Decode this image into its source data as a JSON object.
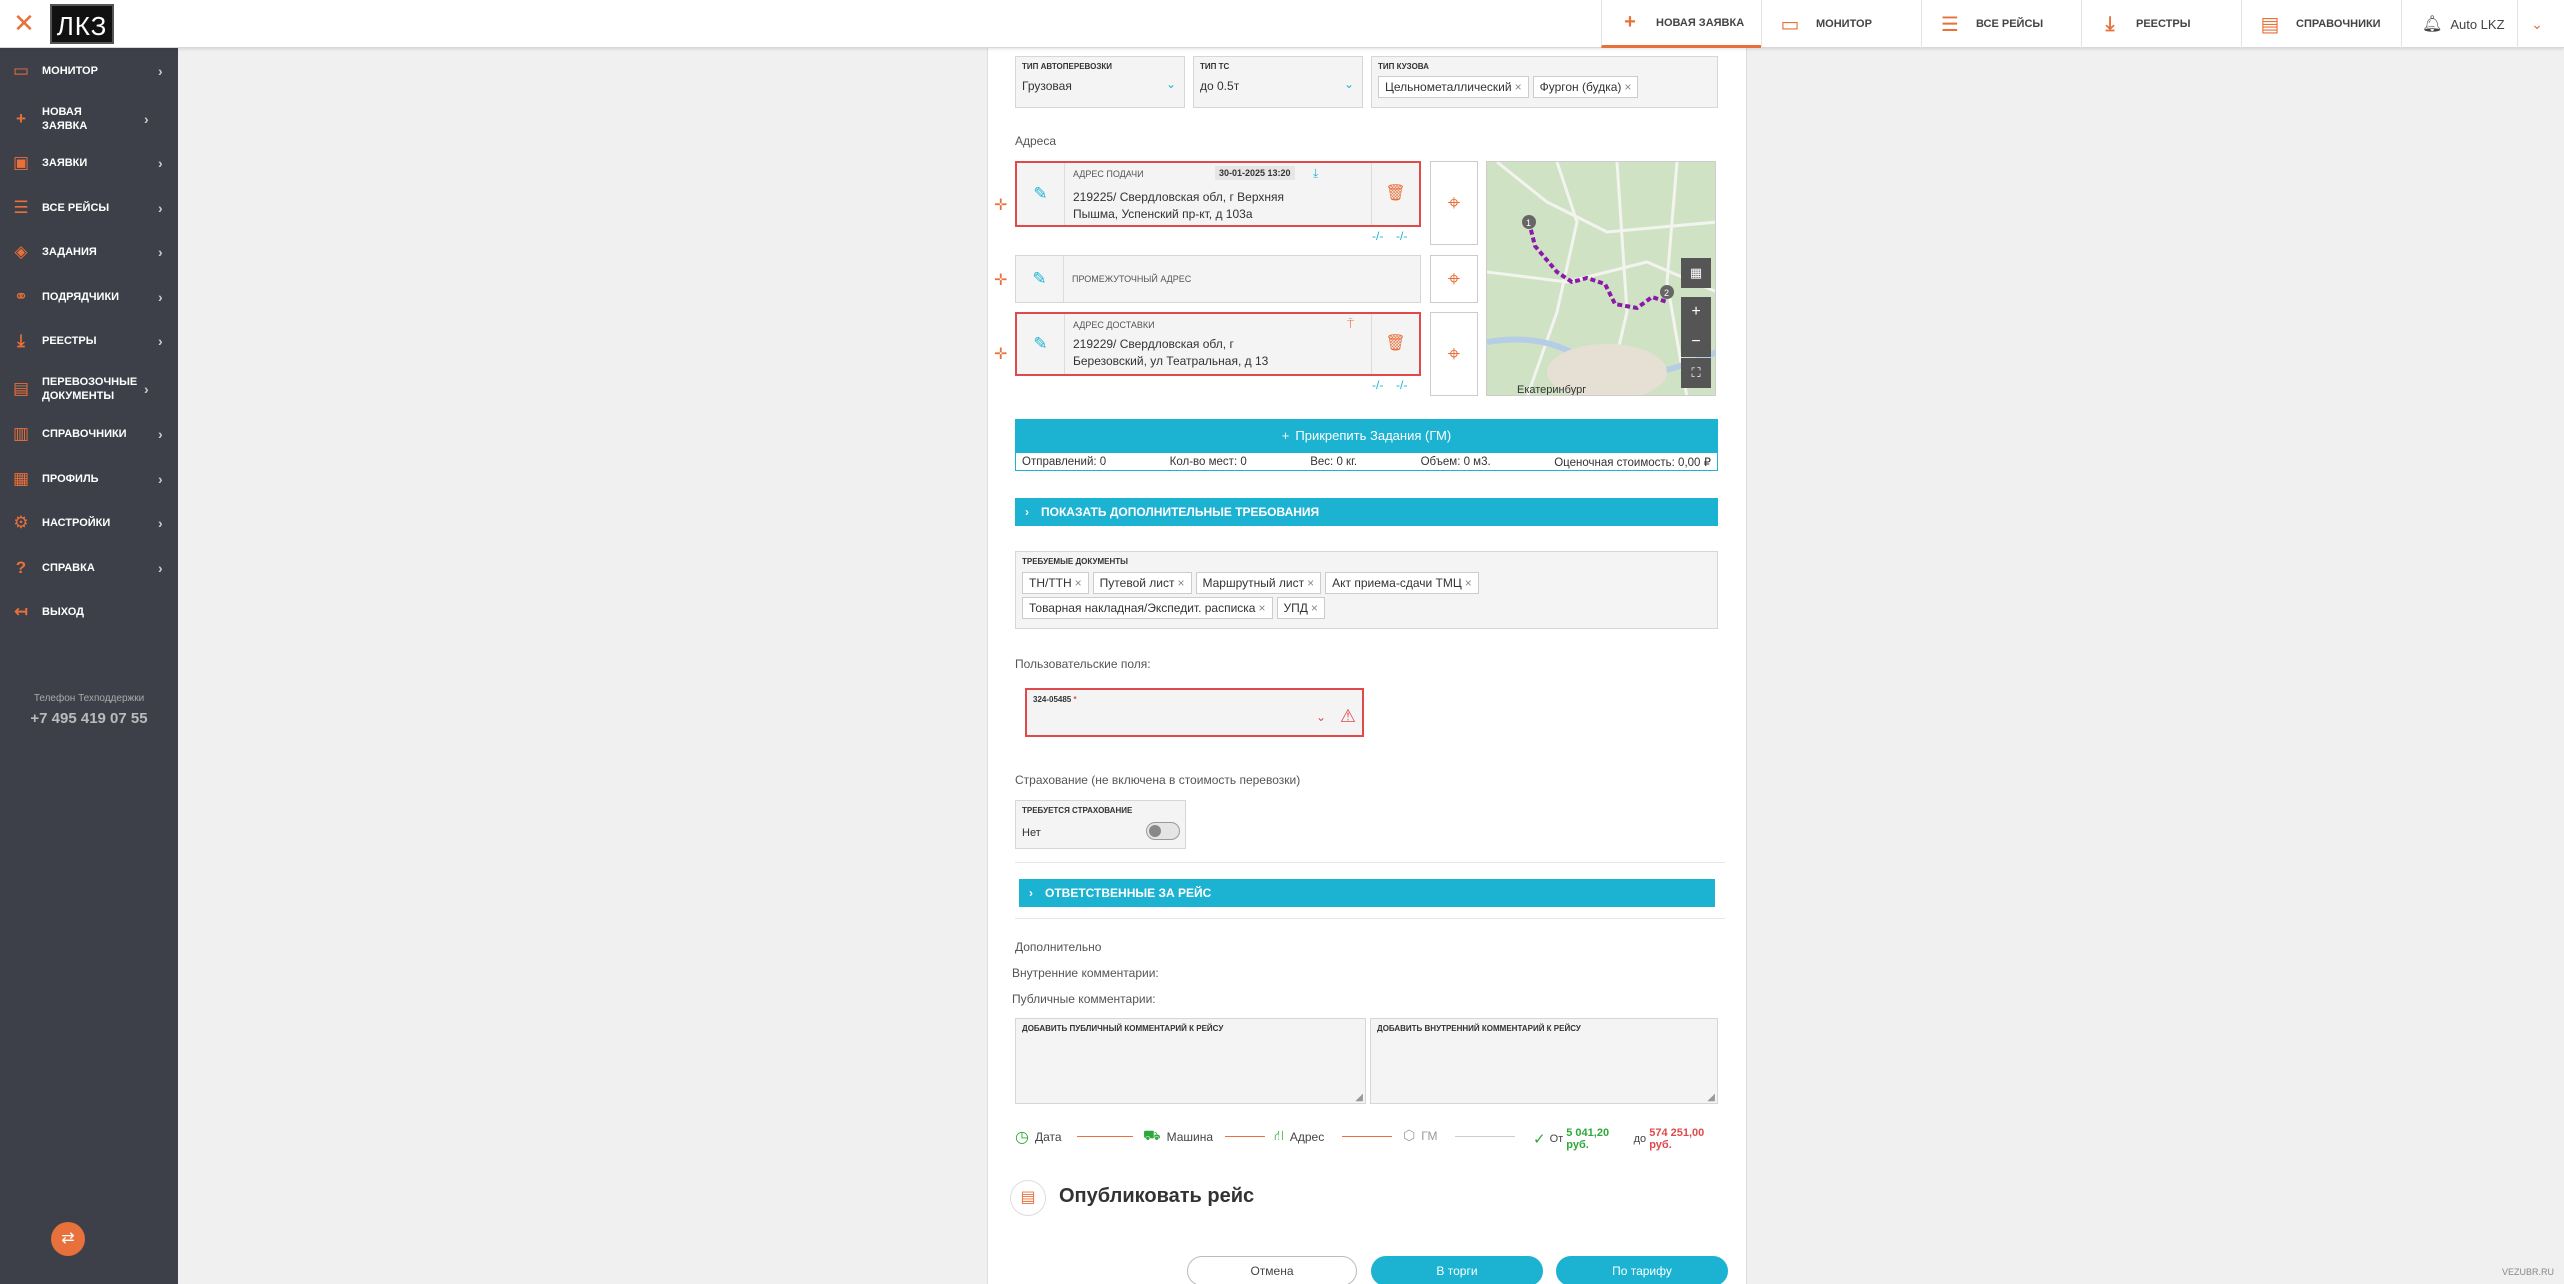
{
  "header": {
    "logo_text": "ЛКЗ",
    "nav": [
      {
        "label": "НОВАЯ ЗАЯВКА",
        "icon": "plus-icon"
      },
      {
        "label": "МОНИТОР",
        "icon": "monitor-icon"
      },
      {
        "label": "ВСЕ РЕЙСЫ",
        "icon": "list-icon"
      },
      {
        "label": "РЕЕСТРЫ",
        "icon": "download-icon"
      },
      {
        "label": "СПРАВОЧНИКИ",
        "icon": "book-icon"
      }
    ],
    "user_name": "Auto LKZ"
  },
  "sidebar": {
    "items": [
      {
        "label": "МОНИТОР"
      },
      {
        "label": "НОВАЯ ЗАЯВКА"
      },
      {
        "label": "ЗАЯВКИ"
      },
      {
        "label": "ВСЕ РЕЙСЫ"
      },
      {
        "label": "ЗАДАНИЯ"
      },
      {
        "label": "ПОДРЯДЧИКИ"
      },
      {
        "label": "РЕЕСТРЫ"
      },
      {
        "label": "ПЕРЕВОЗОЧНЫЕ ДОКУМЕНТЫ"
      },
      {
        "label": "СПРАВОЧНИКИ"
      },
      {
        "label": "ПРОФИЛЬ"
      },
      {
        "label": "НАСТРОЙКИ"
      },
      {
        "label": "СПРАВКА"
      },
      {
        "label": "ВЫХОД"
      }
    ],
    "support_label": "Телефон Техподдержки",
    "support_phone": "+7 495 419 07 55"
  },
  "form": {
    "transport_type": {
      "label": "ТИП АВТОПЕРЕВОЗКИ",
      "value": "Грузовая"
    },
    "vehicle_type": {
      "label": "ТИП ТС",
      "value": "до 0.5т"
    },
    "body_type": {
      "label": "ТИП КУЗОВА",
      "chips": [
        "Цельнометаллический",
        "Фургон (будка)"
      ]
    },
    "addresses_title": "Адреса",
    "pickup": {
      "label": "АДРЕС ПОДАЧИ",
      "datetime": "30-01-2025 13:20",
      "line1": "219225/ Свердловская обл, г Верхняя",
      "line2": "Пышма, Успенский пр-кт, д 103а"
    },
    "intermediate": {
      "label": "ПРОМЕЖУТОЧНЫЙ АДРЕС"
    },
    "delivery": {
      "label": "АДРЕС ДОСТАВКИ",
      "line1": "219229/ Свердловская обл, г",
      "line2": "Березовский, ул Театральная, д 13"
    },
    "slash_text": "-/-",
    "map_city": "Екатеринбург",
    "attach_button": "Прикрепить Задания (ГМ)",
    "stats": {
      "shipments": "Отправлений: 0",
      "places": "Кол-во мест: 0",
      "weight": "Вес: 0 кг.",
      "volume": "Объем: 0 м3.",
      "cost": "Оценочная стоимость: 0,00 ₽"
    },
    "show_requirements": "ПОКАЗАТЬ ДОПОЛНИТЕЛЬНЫЕ ТРЕБОВАНИЯ",
    "required_docs": {
      "label": "ТРЕБУЕМЫЕ ДОКУМЕНТЫ",
      "row1": [
        "ТН/ТТН",
        "Путевой лист",
        "Маршрутный лист",
        "Акт приема-сдачи ТМЦ"
      ],
      "row2": [
        "Товарная накладная/Экспедит. расписка",
        "УПД"
      ]
    },
    "custom_fields_title": "Пользовательские поля:",
    "custom_field": {
      "label": "324-05485",
      "required_mark": "*"
    },
    "insurance_title": "Страхование (не включена в стоимость перевозки)",
    "insurance": {
      "label": "ТРЕБУЕТСЯ СТРАХОВАНИЕ",
      "value": "Нет"
    },
    "responsible": "ОТВЕТСТВЕННЫЕ ЗА РЕЙС",
    "additional_title": "Дополнительно",
    "internal_comments": "Внутренние комментарии:",
    "public_comments": "Публичные комментарии:",
    "public_comment_label": "ДОБАВИТЬ ПУБЛИЧНЫЙ КОММЕНТАРИЙ К РЕЙСУ",
    "internal_comment_label": "ДОБАВИТЬ ВНУТРЕННИЙ КОММЕНТАРИЙ К РЕЙСУ",
    "steps": {
      "date": "Дата",
      "car": "Машина",
      "address": "Адрес",
      "gm": "ГМ",
      "price_from_label": "От",
      "price_from": "5 041,20 руб.",
      "price_to_label": "до",
      "price_to": "574 251,00 руб."
    },
    "publish_title": "Опубликовать рейс",
    "buttons": {
      "cancel": "Отмена",
      "tender": "В торги",
      "tariff": "По тарифу"
    }
  },
  "watermark": "VEZUBR.RU",
  "colors": {
    "accent": "#e8703a",
    "primary": "#1cb2d2",
    "error": "#e04a4a",
    "success": "#2ea83a",
    "sidebar": "#3e4049"
  }
}
